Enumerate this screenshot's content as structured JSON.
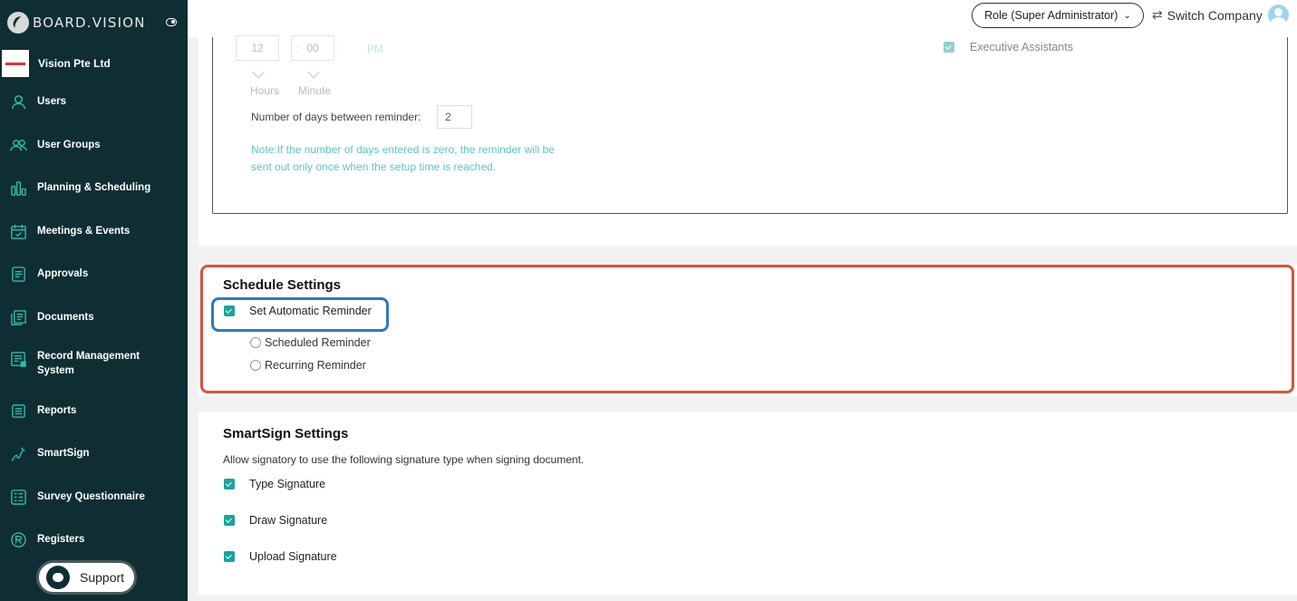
{
  "brand": {
    "name": "BOARD.VISION"
  },
  "company": {
    "name": "Vision Pte Ltd"
  },
  "sidebar": {
    "items": [
      {
        "label": "Users",
        "icon": "user-icon"
      },
      {
        "label": "User Groups",
        "icon": "users-icon"
      },
      {
        "label": "Planning & Scheduling",
        "icon": "bar-chart-icon"
      },
      {
        "label": "Meetings & Events",
        "icon": "calendar-check-icon"
      },
      {
        "label": "Approvals",
        "icon": "approval-doc-icon"
      },
      {
        "label": "Documents",
        "icon": "documents-icon"
      },
      {
        "label": "Record Management System",
        "icon": "record-icon"
      },
      {
        "label": "Reports",
        "icon": "report-icon"
      },
      {
        "label": "SmartSign",
        "icon": "signature-icon"
      },
      {
        "label": "Survey Questionnaire",
        "icon": "survey-icon"
      },
      {
        "label": "Registers",
        "icon": "registered-icon"
      }
    ],
    "support_label": "Support"
  },
  "header": {
    "role_label": "Role (Super Administrator)",
    "switch_company_label": "Switch Company"
  },
  "reminder": {
    "hour": "12",
    "minute": "00",
    "ampm": "PM",
    "hours_label": "Hours",
    "minute_label": "Minute",
    "days_label": "Number of days between reminder:",
    "days_value": "2",
    "note": "Note:If the number of days entered is zero, the reminder will be sent out only once when the setup time is reached.",
    "exec_assistants_label": "Executive Assistants"
  },
  "schedule_settings": {
    "title": "Schedule Settings",
    "auto_reminder_label": "Set Automatic Reminder",
    "auto_reminder_checked": true,
    "options": [
      "Scheduled Reminder",
      "Recurring Reminder"
    ]
  },
  "smartsign_settings": {
    "title": "SmartSign Settings",
    "description": "Allow signatory to use the following signature type when signing document.",
    "types": [
      {
        "label": "Type Signature",
        "checked": true
      },
      {
        "label": "Draw Signature",
        "checked": true
      },
      {
        "label": "Upload Signature",
        "checked": true
      }
    ]
  },
  "colors": {
    "sidebar_bg": "#0f2e33",
    "accent": "#1aa3a0",
    "highlight_red": "#d9533a",
    "highlight_blue": "#2f79c0"
  }
}
